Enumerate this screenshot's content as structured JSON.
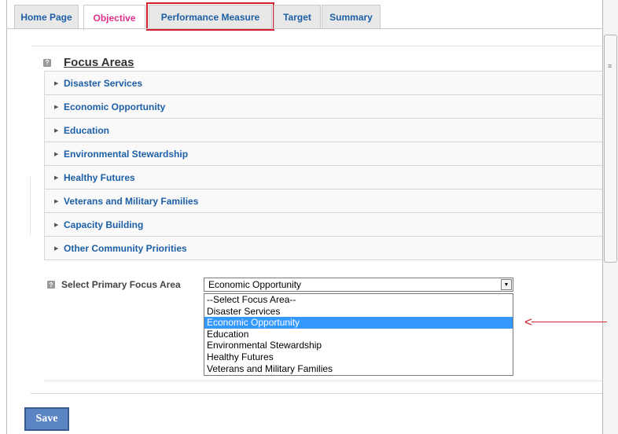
{
  "tabs": [
    {
      "label": "Home Page"
    },
    {
      "label": "Objective"
    },
    {
      "label": "Performance Measure"
    },
    {
      "label": "Target"
    },
    {
      "label": "Summary"
    }
  ],
  "focus_areas": {
    "help_icon": "?",
    "title": "Focus Areas",
    "items": [
      {
        "label": "Disaster Services"
      },
      {
        "label": "Economic Opportunity"
      },
      {
        "label": "Education"
      },
      {
        "label": "Environmental Stewardship"
      },
      {
        "label": "Healthy Futures"
      },
      {
        "label": "Veterans and Military Families"
      },
      {
        "label": "Capacity Building"
      },
      {
        "label": "Other Community Priorities"
      }
    ]
  },
  "primary_focus": {
    "label": "Select Primary Focus Area",
    "selected": "Economic Opportunity",
    "options": [
      "--Select Focus Area--",
      "Disaster Services",
      "Economic Opportunity",
      "Education",
      "Environmental Stewardship",
      "Healthy Futures",
      "Veterans and Military Families"
    ]
  },
  "save_label": "Save",
  "colors": {
    "link_blue": "#1d5fa5",
    "active_tab_pink": "#e0308d",
    "highlight_red": "#d21f2c",
    "selected_option_blue": "#3399ff",
    "save_button_blue": "#5b84c2"
  },
  "icons": {
    "accordion": "triangle-right-icon",
    "dropdown": "triangle-down-icon",
    "arrow": "left-arrow-icon"
  }
}
